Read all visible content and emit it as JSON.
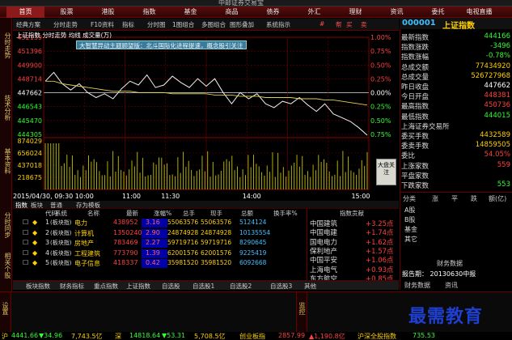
{
  "window": {
    "title": "中邮证券交易宝"
  },
  "topnav": [
    "首页",
    "股票",
    "港股",
    "指数",
    "基金",
    "商品",
    "债券",
    "外汇",
    "理财",
    "资讯",
    "委托",
    "电视直播"
  ],
  "leftbar": [
    "分时走势",
    "技术分析",
    "基本资料",
    "分时成交"
  ],
  "toolbar": [
    "经典方案",
    "分时走势",
    "F10资料",
    "指标",
    "分时图",
    "1图组合",
    "多图组合",
    "图形叠加",
    "系统指示",
    "#",
    "帮",
    "买",
    "卖"
  ],
  "chart": {
    "header": "上证指数 分时走势 均线 成交量(万)",
    "banner": "大智慧异动主题顾望版：北斗国际化进程提速，概念股引关注",
    "price_labels": [
      "452139",
      "451396",
      "449900",
      "448714",
      "447662",
      "446543",
      "445470",
      "444305"
    ],
    "pct_labels": [
      "1.00%",
      "0.75%",
      "0.50%",
      "0.25%",
      "0.00%",
      "0.25%",
      "0.50%",
      "0.75%"
    ],
    "vol_labels": [
      "874029",
      "656024",
      "437018",
      "218675"
    ],
    "date_label": "2015/04/30, 09:30 10:00",
    "time_labels": [
      "11:00",
      "11:30",
      "14:00",
      "15:00"
    ],
    "dapan_btn": "大盘关注"
  },
  "chart_data": {
    "type": "line",
    "title": "上证指数",
    "xlabel": "",
    "ylabel": "",
    "ylim": [
      443800,
      452500
    ],
    "series": [
      {
        "name": "分时",
        "values": [
          449000,
          449700,
          448800,
          448300,
          448800,
          448100,
          447700,
          448000,
          447600,
          448400,
          449000,
          448700,
          449500,
          448500,
          448700,
          449400,
          448900,
          448500,
          449200,
          448600,
          449200,
          448100,
          447200,
          448100,
          447600,
          448000,
          447200,
          446900,
          447400,
          447200,
          447700,
          447100,
          446600,
          447200,
          446400,
          446100,
          445800,
          445300,
          444700
        ]
      },
      {
        "name": "均线",
        "values": [
          449000,
          449000,
          448800,
          448700,
          448600,
          448500,
          448400,
          448300,
          448200,
          448200,
          448200,
          448100,
          448100,
          448100,
          448100,
          448000,
          448000,
          448000,
          448000,
          448000,
          447900,
          447900,
          447900,
          447800,
          447800,
          447800,
          447700,
          447700,
          447700,
          447700,
          447600,
          447600,
          447600,
          447500,
          447500,
          447400,
          447300,
          447200,
          447100
        ]
      }
    ],
    "x": [
      "09:30",
      "15:00"
    ]
  },
  "table": {
    "tabs": [
      "指数",
      "板块",
      "普通",
      "存为模板"
    ],
    "headers": [
      "代码",
      "系统",
      "名称",
      "最新",
      "涨幅%",
      "总手",
      "现手",
      "总额",
      "换手率%"
    ],
    "rows": [
      {
        "idx": "1",
        "sys": "(板块指)",
        "name": "电力",
        "last": "438952",
        "chg": "3.16",
        "vol": "55063576",
        "cur": "55063576",
        "amt": "5124124"
      },
      {
        "idx": "2",
        "sys": "(板块指)",
        "name": "计算机",
        "last": "1350240",
        "chg": "2.90",
        "vol": "24874928",
        "cur": "24874928",
        "amt": "10135554"
      },
      {
        "idx": "3",
        "sys": "(板块指)",
        "name": "房地产",
        "last": "783469",
        "chg": "2.27",
        "vol": "59719716",
        "cur": "59719716",
        "amt": "8290645"
      },
      {
        "idx": "4",
        "sys": "(板块指)",
        "name": "工程建筑",
        "last": "773790",
        "chg": "1.39",
        "vol": "62001576",
        "cur": "62001576",
        "amt": "9225419"
      },
      {
        "idx": "5",
        "sys": "(板块指)",
        "name": "电子信息",
        "last": "418337",
        "chg": "0.42",
        "vol": "35981520",
        "cur": "35981520",
        "amt": "6092668"
      }
    ],
    "contrib_title": "指数贡献",
    "contrib": [
      {
        "name": "中国建筑",
        "val": "+3.25点"
      },
      {
        "name": "中国电建",
        "val": "+1.74点"
      },
      {
        "name": "国电电力",
        "val": "+1.62点"
      },
      {
        "name": "保利地产",
        "val": "+1.57点"
      },
      {
        "name": "中国平安",
        "val": "+1.06点"
      },
      {
        "name": "上海电气",
        "val": "+0.93点"
      },
      {
        "name": "东方航空",
        "val": "+0.85点"
      }
    ]
  },
  "bottomtabs": [
    "板块指数",
    "财务指标",
    "重点指数",
    "上证指数",
    "自选股",
    "自选股1",
    "自选股2",
    "自选股3",
    "其他"
  ],
  "side_tabs": [
    "分时同步",
    "相关个股"
  ],
  "rightpanel": {
    "code": "000001",
    "name": "上证指数",
    "rows": [
      {
        "k": "最新指数",
        "v": "444166",
        "c": "green"
      },
      {
        "k": "指数涨跌",
        "v": "-3496",
        "c": "green"
      },
      {
        "k": "指数涨幅",
        "v": "-0.78%",
        "c": "green"
      },
      {
        "k": "总成交额",
        "v": "77434920",
        "c": "yellow"
      },
      {
        "k": "总成交量",
        "v": "526727968",
        "c": "yellow"
      },
      {
        "k": "昨日收盘",
        "v": "447662",
        "c": "white"
      },
      {
        "k": "今日开盘",
        "v": "448381",
        "c": "red"
      },
      {
        "k": "最高指数",
        "v": "450736",
        "c": "red"
      },
      {
        "k": "最低指数",
        "v": "444015",
        "c": "green"
      },
      {
        "k": "上海证券交易所",
        "v": "",
        "c": "white"
      },
      {
        "k": "委买手数",
        "v": "4432589",
        "c": "yellow"
      },
      {
        "k": "委卖手数",
        "v": "14859505",
        "c": "yellow"
      },
      {
        "k": "委比",
        "v": "54.05%",
        "c": "red"
      },
      {
        "k": "上涨家数",
        "v": "559",
        "c": "red"
      },
      {
        "k": "平盘家数",
        "v": "",
        "c": "white"
      },
      {
        "k": "下跌家数",
        "v": "553",
        "c": "green"
      }
    ],
    "sub_headers": [
      "分类",
      "涨",
      "平",
      "跌",
      "额(亿)"
    ],
    "sub_rows": [
      "A股",
      "B股",
      "基金",
      "其它"
    ],
    "report_label": "财务数据",
    "report_date": "报告期： 20130630中报",
    "report_tabs": [
      "财务数据",
      "资讯"
    ]
  },
  "status": {
    "left_tabs": [
      "设置"
    ],
    "right_tabs": [
      "监控"
    ]
  },
  "ticker": [
    "沪",
    "4441.66",
    "▼34.96",
    "7,743.5亿",
    "深",
    "14818.64",
    "▼53.31",
    "5,708.5亿",
    "创业板指",
    "2857.99",
    "▲1,190.8亿",
    "沪深全股指数",
    "735.53"
  ],
  "watermark": "最需教育"
}
